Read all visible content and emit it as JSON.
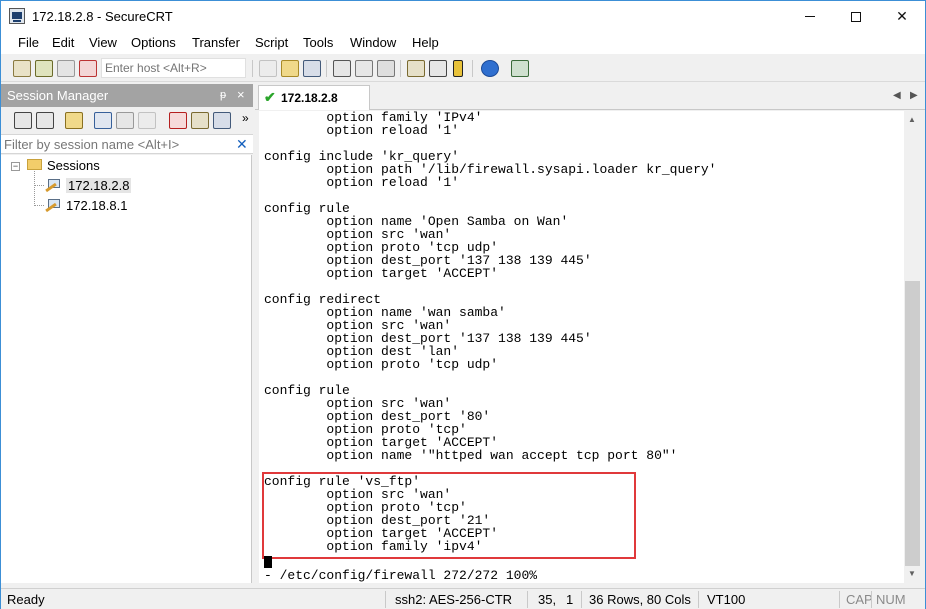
{
  "window": {
    "title": "172.18.2.8 - SecureCRT",
    "minimize_glyph": "",
    "close_glyph": "✕"
  },
  "menu": [
    "File",
    "Edit",
    "View",
    "Options",
    "Transfer",
    "Script",
    "Tools",
    "Window",
    "Help"
  ],
  "toolbar": {
    "host_placeholder": "Enter host <Alt+R>",
    "icons": [
      "connect-icon",
      "quick-connect-icon",
      "connect-in-tab-icon",
      "disconnect-icon",
      "copy-icon",
      "paste-icon",
      "find-icon",
      "print-icon",
      "print-setup-icon",
      "log-session-icon",
      "session-options-icon",
      "global-options-icon",
      "keymap-icon",
      "help-icon",
      "sftp-icon"
    ]
  },
  "session_manager": {
    "title": "Session Manager",
    "pin": "ᵽ",
    "close": "×",
    "filter_placeholder": "Filter by session name <Alt+I>",
    "filter_clear": "✕",
    "root": {
      "label": "Sessions",
      "expander": "−"
    },
    "sessions": [
      "172.18.2.8",
      "172.18.8.1"
    ]
  },
  "tabs": [
    {
      "label": "172.18.2.8",
      "status_glyph": "✔"
    }
  ],
  "tab_nav": {
    "prev": "◀",
    "next": "▶"
  },
  "terminal": {
    "lines": [
      "        option family 'IPv4'",
      "        option reload '1'",
      "",
      "config include 'kr_query'",
      "        option path '/lib/firewall.sysapi.loader kr_query'",
      "        option reload '1'",
      "",
      "config rule",
      "        option name 'Open Samba on Wan'",
      "        option src 'wan'",
      "        option proto 'tcp udp'",
      "        option dest_port '137 138 139 445'",
      "        option target 'ACCEPT'",
      "",
      "config redirect",
      "        option name 'wan samba'",
      "        option src 'wan'",
      "        option dest_port '137 138 139 445'",
      "        option dest 'lan'",
      "        option proto 'tcp udp'",
      "",
      "config rule",
      "        option src 'wan'",
      "        option dest_port '80'",
      "        option proto 'tcp'",
      "        option target 'ACCEPT'",
      "        option name '\"httped wan accept tcp port 80\"'",
      "",
      "config rule 'vs_ftp'",
      "        option src 'wan'",
      "        option proto 'tcp'",
      "        option dest_port '21'",
      "        option target 'ACCEPT'",
      "        option family 'ipv4'"
    ],
    "status_line": "- /etc/config/firewall 272/272 100%"
  },
  "statusbar": {
    "ready": "Ready",
    "encryption": "ssh2: AES-256-CTR",
    "row": "35,",
    "col": "1",
    "size": "36 Rows, 80 Cols",
    "emulation": "VT100",
    "caps": "CAP",
    "num": "NUM"
  },
  "colors": {
    "highlight_border": "#e0393b",
    "accent": "#1560bd"
  }
}
